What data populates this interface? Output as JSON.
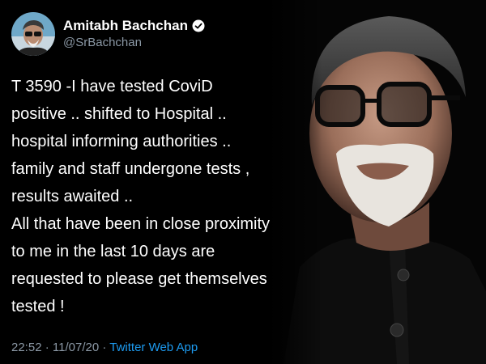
{
  "tweet": {
    "display_name": "Amitabh Bachchan",
    "handle": "@SrBachchan",
    "verified_icon": "verified-badge-icon",
    "body_lines": [
      "T 3590 -I have tested CoviD",
      "positive ..  shifted to Hospital  ..",
      "hospital informing  authorities ..",
      "family and staff undergone tests ,",
      "results awaited ..",
      "All that have been in close proximity",
      "to me in the last 10 days are",
      "requested to please get themselves",
      "tested !"
    ],
    "time": "22:52",
    "date": "11/07/20",
    "separator1": " · ",
    "separator2": " · ",
    "source_app": "Twitter Web App"
  },
  "colors": {
    "background": "#000000",
    "text": "#ffffff",
    "muted": "#8b98a5",
    "link": "#1d9bf0"
  }
}
